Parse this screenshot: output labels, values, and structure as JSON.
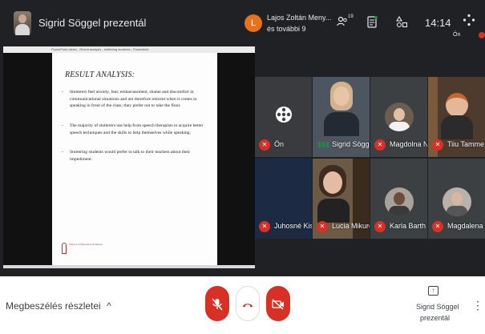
{
  "header": {
    "presenting_title": "Sigrid Söggel prezentál",
    "notification_initial": "L",
    "notification_line1": "Lajos Zoltán Meny...",
    "notification_line2": "és további 9",
    "people_count": "19",
    "clock": "14:14",
    "self_label": "Ön"
  },
  "document": {
    "viewer_bar_text": "PowerPoint slides - Result analysis - stuttering students - Powerslide",
    "title": "RESULT ANALYSIS:",
    "bullets": [
      "Stutterers feel anxiety, fear, embarrassment, shame and discomfort in communicational situations and are therefore reticent when it comes to speaking in front of the class; they prefer not to take the floor.",
      "The majority of stutterers use help from speech therapists to acquire better speech techniques and the skills to help themselves while speaking.",
      "Stuttering students would prefer to talk to their teachers about their impediment."
    ],
    "logo_text": "School of Education Sciences"
  },
  "participants": [
    {
      "name": "Ön"
    },
    {
      "name": "Sigrid Söggel"
    },
    {
      "name": "Magdolna N..."
    },
    {
      "name": "Tiiu Tamme..."
    },
    {
      "name": "Juhosné Kis..."
    },
    {
      "name": "Lucia Mikurcov..."
    },
    {
      "name": "Karla Barth"
    },
    {
      "name": "Magdalena ..."
    }
  ],
  "footer": {
    "meeting_details": "Megbeszélés részletei",
    "presenting_line1": "Sigrid Söggel",
    "presenting_line2": "prezentál"
  },
  "colors": {
    "background": "#202124",
    "mic_off_red": "#d93025",
    "notification_avatar": "#e8711a",
    "speaking_green": "#1e8e3e"
  }
}
